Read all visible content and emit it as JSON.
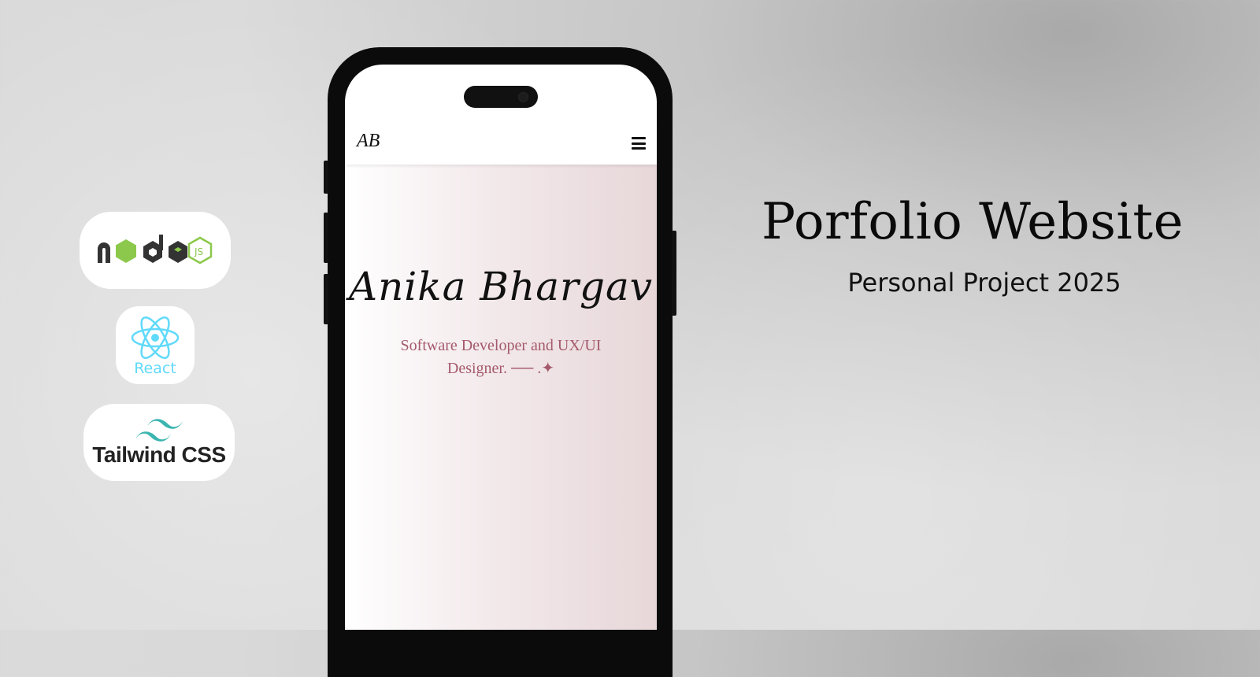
{
  "tech_stack": {
    "node_label": "node",
    "react_label": "React",
    "tailwind_label": "Tailwind CSS"
  },
  "phone_screen": {
    "navbar": {
      "logo": "AB"
    },
    "hero": {
      "name": "Anika Bhargav",
      "tagline": "Software Developer and UX/UI Designer. ── .✦"
    }
  },
  "heading": {
    "title": "Porfolio Website",
    "subtitle": "Personal Project 2025"
  },
  "colors": {
    "tagline": "#a55a6c",
    "react": "#61dafb",
    "node_green": "#8cc84b",
    "tailwind": "#38bdf8"
  }
}
